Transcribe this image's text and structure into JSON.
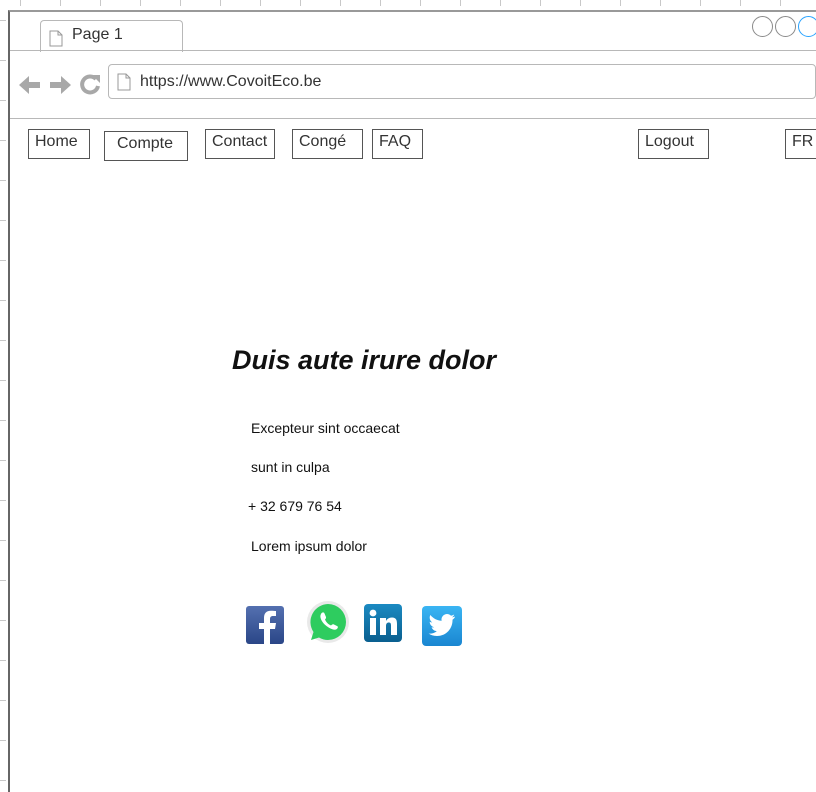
{
  "browser": {
    "tab_label": "Page 1",
    "url": "https://www.CovoitEco.be",
    "accent_color": "#29a3ff"
  },
  "nav": {
    "home": "Home",
    "account": "Compte",
    "contact": "Contact",
    "leave": "Congé",
    "faq": "FAQ",
    "logout": "Logout",
    "language": "FR"
  },
  "content": {
    "title": "Duis aute irure dolor",
    "line1": "Excepteur sint occaecat",
    "line2": "sunt in culpa",
    "phone": "+ 32 679 76 54",
    "line4": "Lorem ipsum dolor"
  },
  "social": {
    "icons": [
      "facebook-icon",
      "whatsapp-icon",
      "linkedin-icon",
      "twitter-icon"
    ],
    "colors": {
      "facebook": "#3b5998",
      "whatsapp": "#25d366",
      "linkedin": "#0e76a8",
      "twitter": "#1da1f2"
    }
  }
}
